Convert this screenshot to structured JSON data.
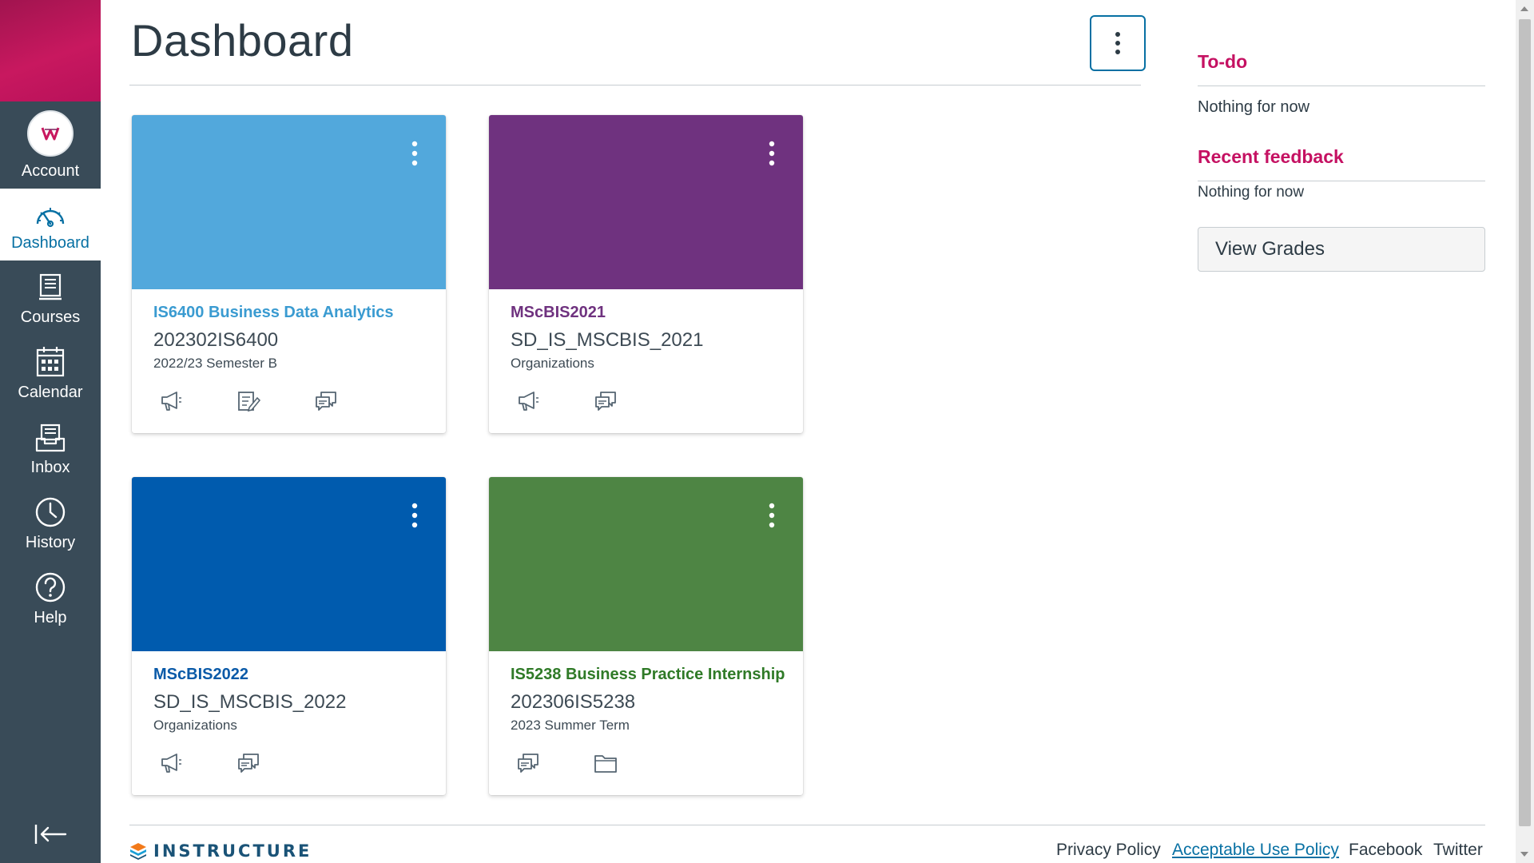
{
  "nav": {
    "items": [
      {
        "label": "Account",
        "icon": "account-avatar-icon"
      },
      {
        "label": "Dashboard",
        "icon": "dashboard-icon"
      },
      {
        "label": "Courses",
        "icon": "courses-icon"
      },
      {
        "label": "Calendar",
        "icon": "calendar-icon"
      },
      {
        "label": "Inbox",
        "icon": "inbox-icon"
      },
      {
        "label": "History",
        "icon": "history-icon"
      },
      {
        "label": "Help",
        "icon": "help-icon"
      }
    ],
    "active": "Dashboard",
    "colors": {
      "background": "#394b58",
      "brand": "#c8185f",
      "active_text": "#0770a3"
    }
  },
  "header": {
    "title": "Dashboard",
    "options_icon": "kebab-menu-icon"
  },
  "cards": [
    {
      "title": "IS6400 Business Data Analytics",
      "code": "202302IS6400",
      "term": "2022/23 Semester B",
      "color": "#52a8dc",
      "icons": [
        "announcements-icon",
        "assignments-icon",
        "discussions-icon"
      ]
    },
    {
      "title": "MScBIS2021",
      "code": "SD_IS_MSCBIS_2021",
      "term": "Organizations",
      "color": "#6f327f",
      "icons": [
        "announcements-icon",
        "discussions-icon"
      ]
    },
    {
      "title": "MScBIS2022",
      "code": "SD_IS_MSCBIS_2022",
      "term": "Organizations",
      "color": "#005bae",
      "icons": [
        "announcements-icon",
        "discussions-icon"
      ]
    },
    {
      "title": "IS5238 Business Practice Internship",
      "code": "202306IS5238",
      "term": "2023 Summer Term",
      "color": "#4e8544",
      "icons": [
        "discussions-icon",
        "files-icon"
      ]
    }
  ],
  "sidebar": {
    "todo": {
      "heading": "To-do",
      "empty": "Nothing for now"
    },
    "feedback": {
      "heading": "Recent feedback",
      "empty": "Nothing for now"
    },
    "view_grades": "View Grades",
    "accent": "#c51162"
  },
  "footer": {
    "logo_text": "INSTRUCTURE",
    "links": [
      "Privacy Policy",
      "Acceptable Use Policy",
      "Facebook",
      "Twitter"
    ]
  }
}
